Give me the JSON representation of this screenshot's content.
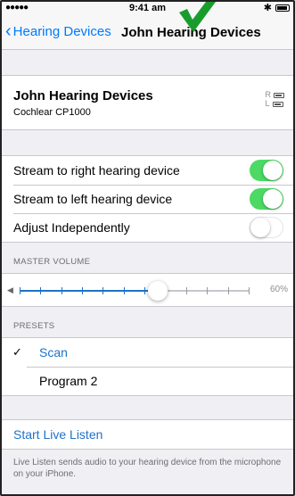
{
  "status_bar": {
    "signal": "●●●●● ",
    "time": "9:41 am",
    "bluetooth": "✱"
  },
  "nav": {
    "back_label": "Hearing Devices",
    "title": "John Hearing Devices"
  },
  "device": {
    "name": "John Hearing Devices",
    "model": "Cochlear CP1000",
    "right_label": "R",
    "left_label": "L"
  },
  "streaming": {
    "rows": [
      {
        "label": "Stream to right hearing device",
        "on": true
      },
      {
        "label": "Stream to left hearing device",
        "on": true
      },
      {
        "label": "Adjust Independently",
        "on": false
      }
    ]
  },
  "master_volume": {
    "header": "MASTER VOLUME",
    "percent_label": "60%",
    "value": 0.6
  },
  "presets": {
    "header": "PRESETS",
    "items": [
      {
        "label": "Scan",
        "selected": true
      },
      {
        "label": "Program 2",
        "selected": false
      }
    ]
  },
  "live_listen": {
    "label": "Start Live Listen",
    "description": "Live Listen sends audio to your hearing device from the microphone on your iPhone."
  },
  "colors": {
    "accent": "#007aff",
    "toggle_on": "#4cd964",
    "checkmark_annotation": "#1a9c2c"
  }
}
